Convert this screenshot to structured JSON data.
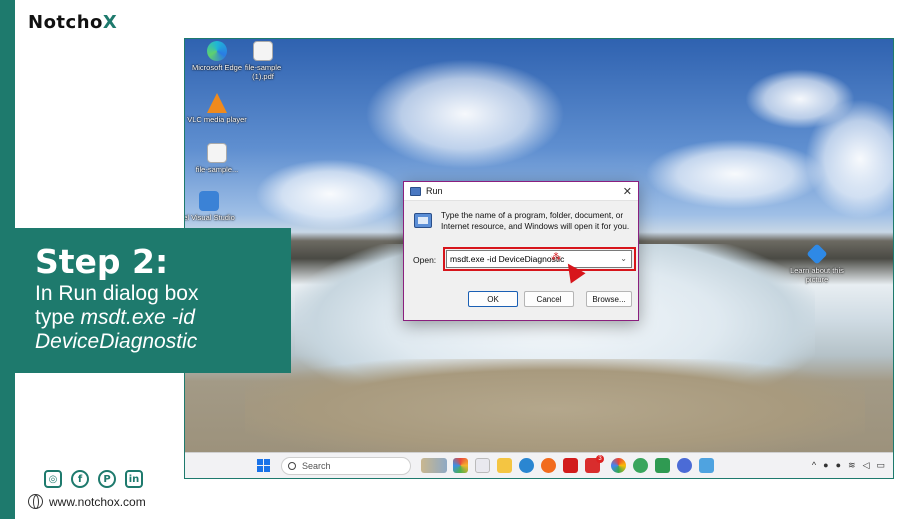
{
  "brand": {
    "name_part1": "Notcho",
    "name_part2": "X",
    "accent": "#1e7a6d"
  },
  "step": {
    "title": "Step 2:",
    "line1": "In Run dialog box",
    "line2_prefix": "type ",
    "line2_italic": "msdt.exe -id",
    "line3_italic": "DeviceDiagnostic"
  },
  "social": {
    "icons": [
      "instagram-icon",
      "facebook-icon",
      "pinterest-icon",
      "linkedin-icon"
    ]
  },
  "website": "www.notchox.com",
  "desktop": {
    "icons": [
      {
        "label": "Microsoft Edge",
        "icon": "edge-icon"
      },
      {
        "label": "file-sample (1).pdf",
        "icon": "pdf-icon"
      },
      {
        "label": "VLC media player",
        "icon": "vlc-icon"
      },
      {
        "label": "file-sample...",
        "icon": "file-icon"
      },
      {
        "label": "el Visual Studio",
        "icon": "visual-studio-icon"
      },
      {
        "label": "Learn about this picture",
        "icon": "learn-picture-icon"
      }
    ]
  },
  "taskbar": {
    "search_label": "Search",
    "badge_count": "3"
  },
  "run_dialog": {
    "title": "Run",
    "close": "✕",
    "description": "Type the name of a program, folder, document, or Internet resource, and Windows will open it for you.",
    "open_label": "Open:",
    "open_value": "msdt.exe -id DeviceDiagnostic",
    "ok_label": "OK",
    "cancel_label": "Cancel",
    "browse_label": "Browse..."
  }
}
